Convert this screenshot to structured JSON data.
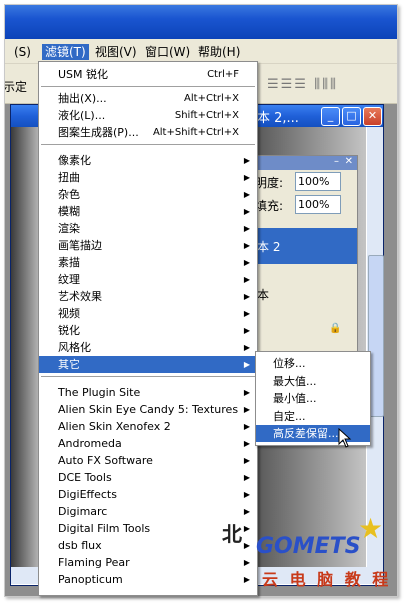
{
  "menubar": {
    "items": [
      {
        "label": "(S)"
      },
      {
        "label": "滤镜(T)",
        "active": true
      },
      {
        "label": "视图(V)"
      },
      {
        "label": "窗口(W)"
      },
      {
        "label": "帮助(H)"
      }
    ],
    "left_cut": "示定"
  },
  "document": {
    "title": "本 2,..."
  },
  "layers": {
    "opacity_label": "明度:",
    "opacity_value": "100%",
    "fill_label": "填充:",
    "fill_value": "100%",
    "layer_selected": "本 2",
    "layer_other": "本"
  },
  "filter_menu": {
    "top_items": [
      {
        "label": "USM 锐化",
        "shortcut": "Ctrl+F"
      },
      {
        "label": "抽出(X)...",
        "shortcut": "Alt+Ctrl+X"
      },
      {
        "label": "液化(L)...",
        "shortcut": "Shift+Ctrl+X"
      },
      {
        "label": "图案生成器(P)...",
        "shortcut": "Alt+Shift+Ctrl+X"
      }
    ],
    "submenus": [
      "像素化",
      "扭曲",
      "杂色",
      "模糊",
      "渲染",
      "画笔描边",
      "素描",
      "纹理",
      "艺术效果",
      "视频",
      "锐化",
      "风格化",
      "其它"
    ],
    "plugins": [
      "The Plugin Site",
      "Alien Skin Eye Candy 5: Textures",
      "Alien Skin Xenofex 2",
      "Andromeda",
      "Auto FX Software",
      "DCE Tools",
      "DigiEffects",
      "Digimarc",
      "Digital Film Tools",
      "dsb flux",
      "Flaming Pear",
      "Panopticum"
    ],
    "selected": "其它"
  },
  "other_submenu": {
    "items": [
      "位移...",
      "最大值...",
      "最小值...",
      "自定...",
      "高反差保留..."
    ],
    "selected": "高反差保留..."
  },
  "watermark": {
    "text1": "北",
    "text2": "GOMETS",
    "text3": "云 电 脑 教 程"
  },
  "colors": {
    "menu_highlight": "#316ac5",
    "title_blue": "#1a55d0"
  }
}
